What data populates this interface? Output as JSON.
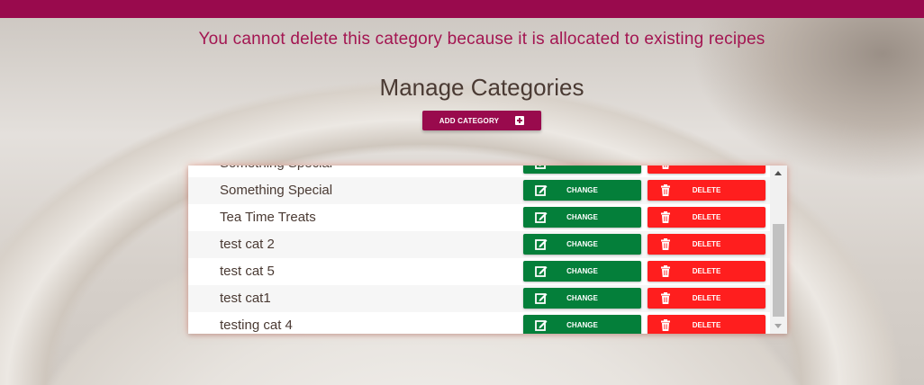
{
  "header": {
    "bar_color": "#990a4d"
  },
  "flash_message": "You cannot delete this category because it is allocated to existing recipes",
  "page_title": "Manage Categories",
  "add_button": {
    "label": "ADD CATEGORY",
    "icon": "plus-square-icon"
  },
  "categories": {
    "rows": [
      {
        "name": "Something Special",
        "change_label": "CHANGE",
        "delete_label": "DELETE"
      },
      {
        "name": "Something Special",
        "change_label": "CHANGE",
        "delete_label": "DELETE"
      },
      {
        "name": "Tea Time Treats",
        "change_label": "CHANGE",
        "delete_label": "DELETE"
      },
      {
        "name": "test cat 2",
        "change_label": "CHANGE",
        "delete_label": "DELETE"
      },
      {
        "name": "test cat 5",
        "change_label": "CHANGE",
        "delete_label": "DELETE"
      },
      {
        "name": "test cat1",
        "change_label": "CHANGE",
        "delete_label": "DELETE"
      },
      {
        "name": "testing cat 4",
        "change_label": "CHANGE",
        "delete_label": "DELETE"
      }
    ]
  },
  "colors": {
    "change": "#047f3a",
    "delete": "#ff1e1e",
    "brand": "#990a4d"
  },
  "icons": {
    "change": "edit-icon",
    "delete": "trash-icon"
  }
}
